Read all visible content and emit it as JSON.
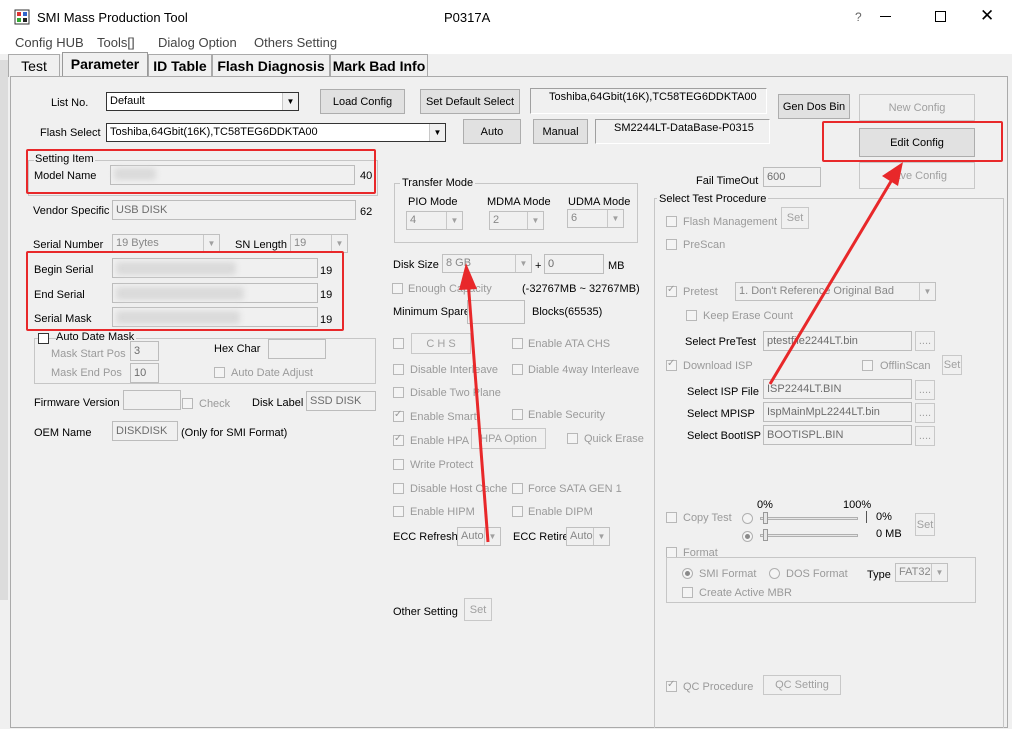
{
  "window": {
    "title": "SMI Mass Production Tool",
    "version": "P0317A"
  },
  "menu": [
    "Config HUB",
    "Tools[]",
    "Dialog Option",
    "Others Setting"
  ],
  "tabs": [
    "Test",
    "Parameter",
    "ID Table",
    "Flash Diagnosis",
    "Mark Bad Info"
  ],
  "top": {
    "list_no_label": "List No.",
    "list_no_value": "Default",
    "load_config": "Load Config",
    "set_default_select": "Set Default Select",
    "flash_info": "Toshiba,64Gbit(16K),TC58TEG6DDKTA00",
    "gen_dos_bin": "Gen Dos Bin",
    "new_config": "New Config",
    "flash_select_label": "Flash Select",
    "flash_select_value": "Toshiba,64Gbit(16K),TC58TEG6DDKTA00",
    "auto": "Auto",
    "manual": "Manual",
    "database": "SM2244LT-DataBase-P0315",
    "edit_config": "Edit Config",
    "save_config": "Save Config"
  },
  "setting_item": {
    "group_label": "Setting Item",
    "model_name_label": "Model Name",
    "model_name_len": "40",
    "vendor_specific_label": "Vendor Specific",
    "vendor_specific_value": "USB DISK",
    "vendor_specific_len": "62",
    "serial_number_label": "Serial Number",
    "serial_number_value": "19 Bytes",
    "sn_length_label": "SN Length",
    "sn_length_value": "19",
    "begin_serial_label": "Begin Serial",
    "begin_serial_len": "19",
    "end_serial_label": "End Serial",
    "end_serial_len": "19",
    "serial_mask_label": "Serial Mask",
    "serial_mask_len": "19",
    "auto_date_mask": "Auto Date Mask",
    "mask_start_pos_label": "Mask Start Pos",
    "mask_start_pos_value": "3",
    "mask_end_pos_label": "Mask End Pos",
    "mask_end_pos_value": "10",
    "hex_char_label": "Hex Char",
    "auto_date_adjust": "Auto Date Adjust",
    "firmware_version_label": "Firmware Version",
    "check": "Check",
    "disk_label_label": "Disk Label",
    "disk_label_value": "SSD DISK",
    "oem_name_label": "OEM Name",
    "oem_name_value": "DISKDISK",
    "oem_note": "(Only for SMI Format)"
  },
  "transfer": {
    "group_label": "Transfer Mode",
    "pio_label": "PIO Mode",
    "pio_value": "4",
    "mdma_label": "MDMA Mode",
    "mdma_value": "2",
    "udma_label": "UDMA Mode",
    "udma_value": "6"
  },
  "disk": {
    "disk_size_label": "Disk Size",
    "disk_size_value": "8 GB",
    "plus": "+",
    "extra_value": "0",
    "unit": "MB",
    "enough_capacity": "Enough Capacity",
    "range": "(-32767MB ~ 32767MB)",
    "minimum_spare_label": "Minimum Spare",
    "blocks": "Blocks(65535)"
  },
  "options": {
    "chs": "C H S",
    "enable_ata_chs": "Enable ATA CHS",
    "disable_interleave": "Disable Interleave",
    "disable_4way": "Diable 4way Interleave",
    "disable_two_plane": "Disable Two Plane",
    "enable_smart": "Enable Smart",
    "enable_security": "Enable Security",
    "enable_hpa": "Enable HPA",
    "hpa_option": "HPA Option",
    "quick_erase": "Quick Erase",
    "write_protect": "Write Protect",
    "disable_host_cache": "Disable Host Cache",
    "force_sata_gen1": "Force SATA GEN 1",
    "enable_hipm": "Enable HIPM",
    "enable_dipm": "Enable DIPM",
    "ecc_refresh_label": "ECC Refresh",
    "ecc_refresh_value": "Auto",
    "ecc_retire_label": "ECC Retire",
    "ecc_retire_value": "Auto",
    "other_setting_label": "Other Setting",
    "set": "Set"
  },
  "procedure": {
    "fail_timeout_label": "Fail TimeOut",
    "fail_timeout_value": "600",
    "group_label": "Select Test Procedure",
    "flash_management": "Flash Management",
    "set": "Set",
    "prescan": "PreScan",
    "pretest": "Pretest",
    "pretest_value": "1. Don't Reference Original Bad",
    "keep_erase_count": "Keep Erase Count",
    "select_pretest_label": "Select PreTest",
    "select_pretest_value": "ptestfile2244LT.bin",
    "browse": "....",
    "download_isp": "Download ISP",
    "offlinscan": "OfflinScan",
    "select_isp_label": "Select ISP File",
    "select_isp_value": "ISP2244LT.BIN",
    "select_mpisp_label": "Select MPISP",
    "select_mpisp_value": "IspMainMpL2244LT.bin",
    "select_bootisp_label": "Select BootISP",
    "select_bootisp_value": "BOOTISPL.BIN",
    "copy_test": "Copy Test",
    "pct_0": "0%",
    "pct_100": "100%",
    "pct_right": "0%",
    "mb_right": "0 MB",
    "format": "Format",
    "smi_format": "SMI Format",
    "dos_format": "DOS Format",
    "type_label": "Type",
    "type_value": "FAT32",
    "create_active_mbr": "Create Active MBR",
    "qc_procedure": "QC Procedure",
    "qc_setting": "QC Setting"
  },
  "colors": {
    "annotation_red": "#e8282a"
  }
}
